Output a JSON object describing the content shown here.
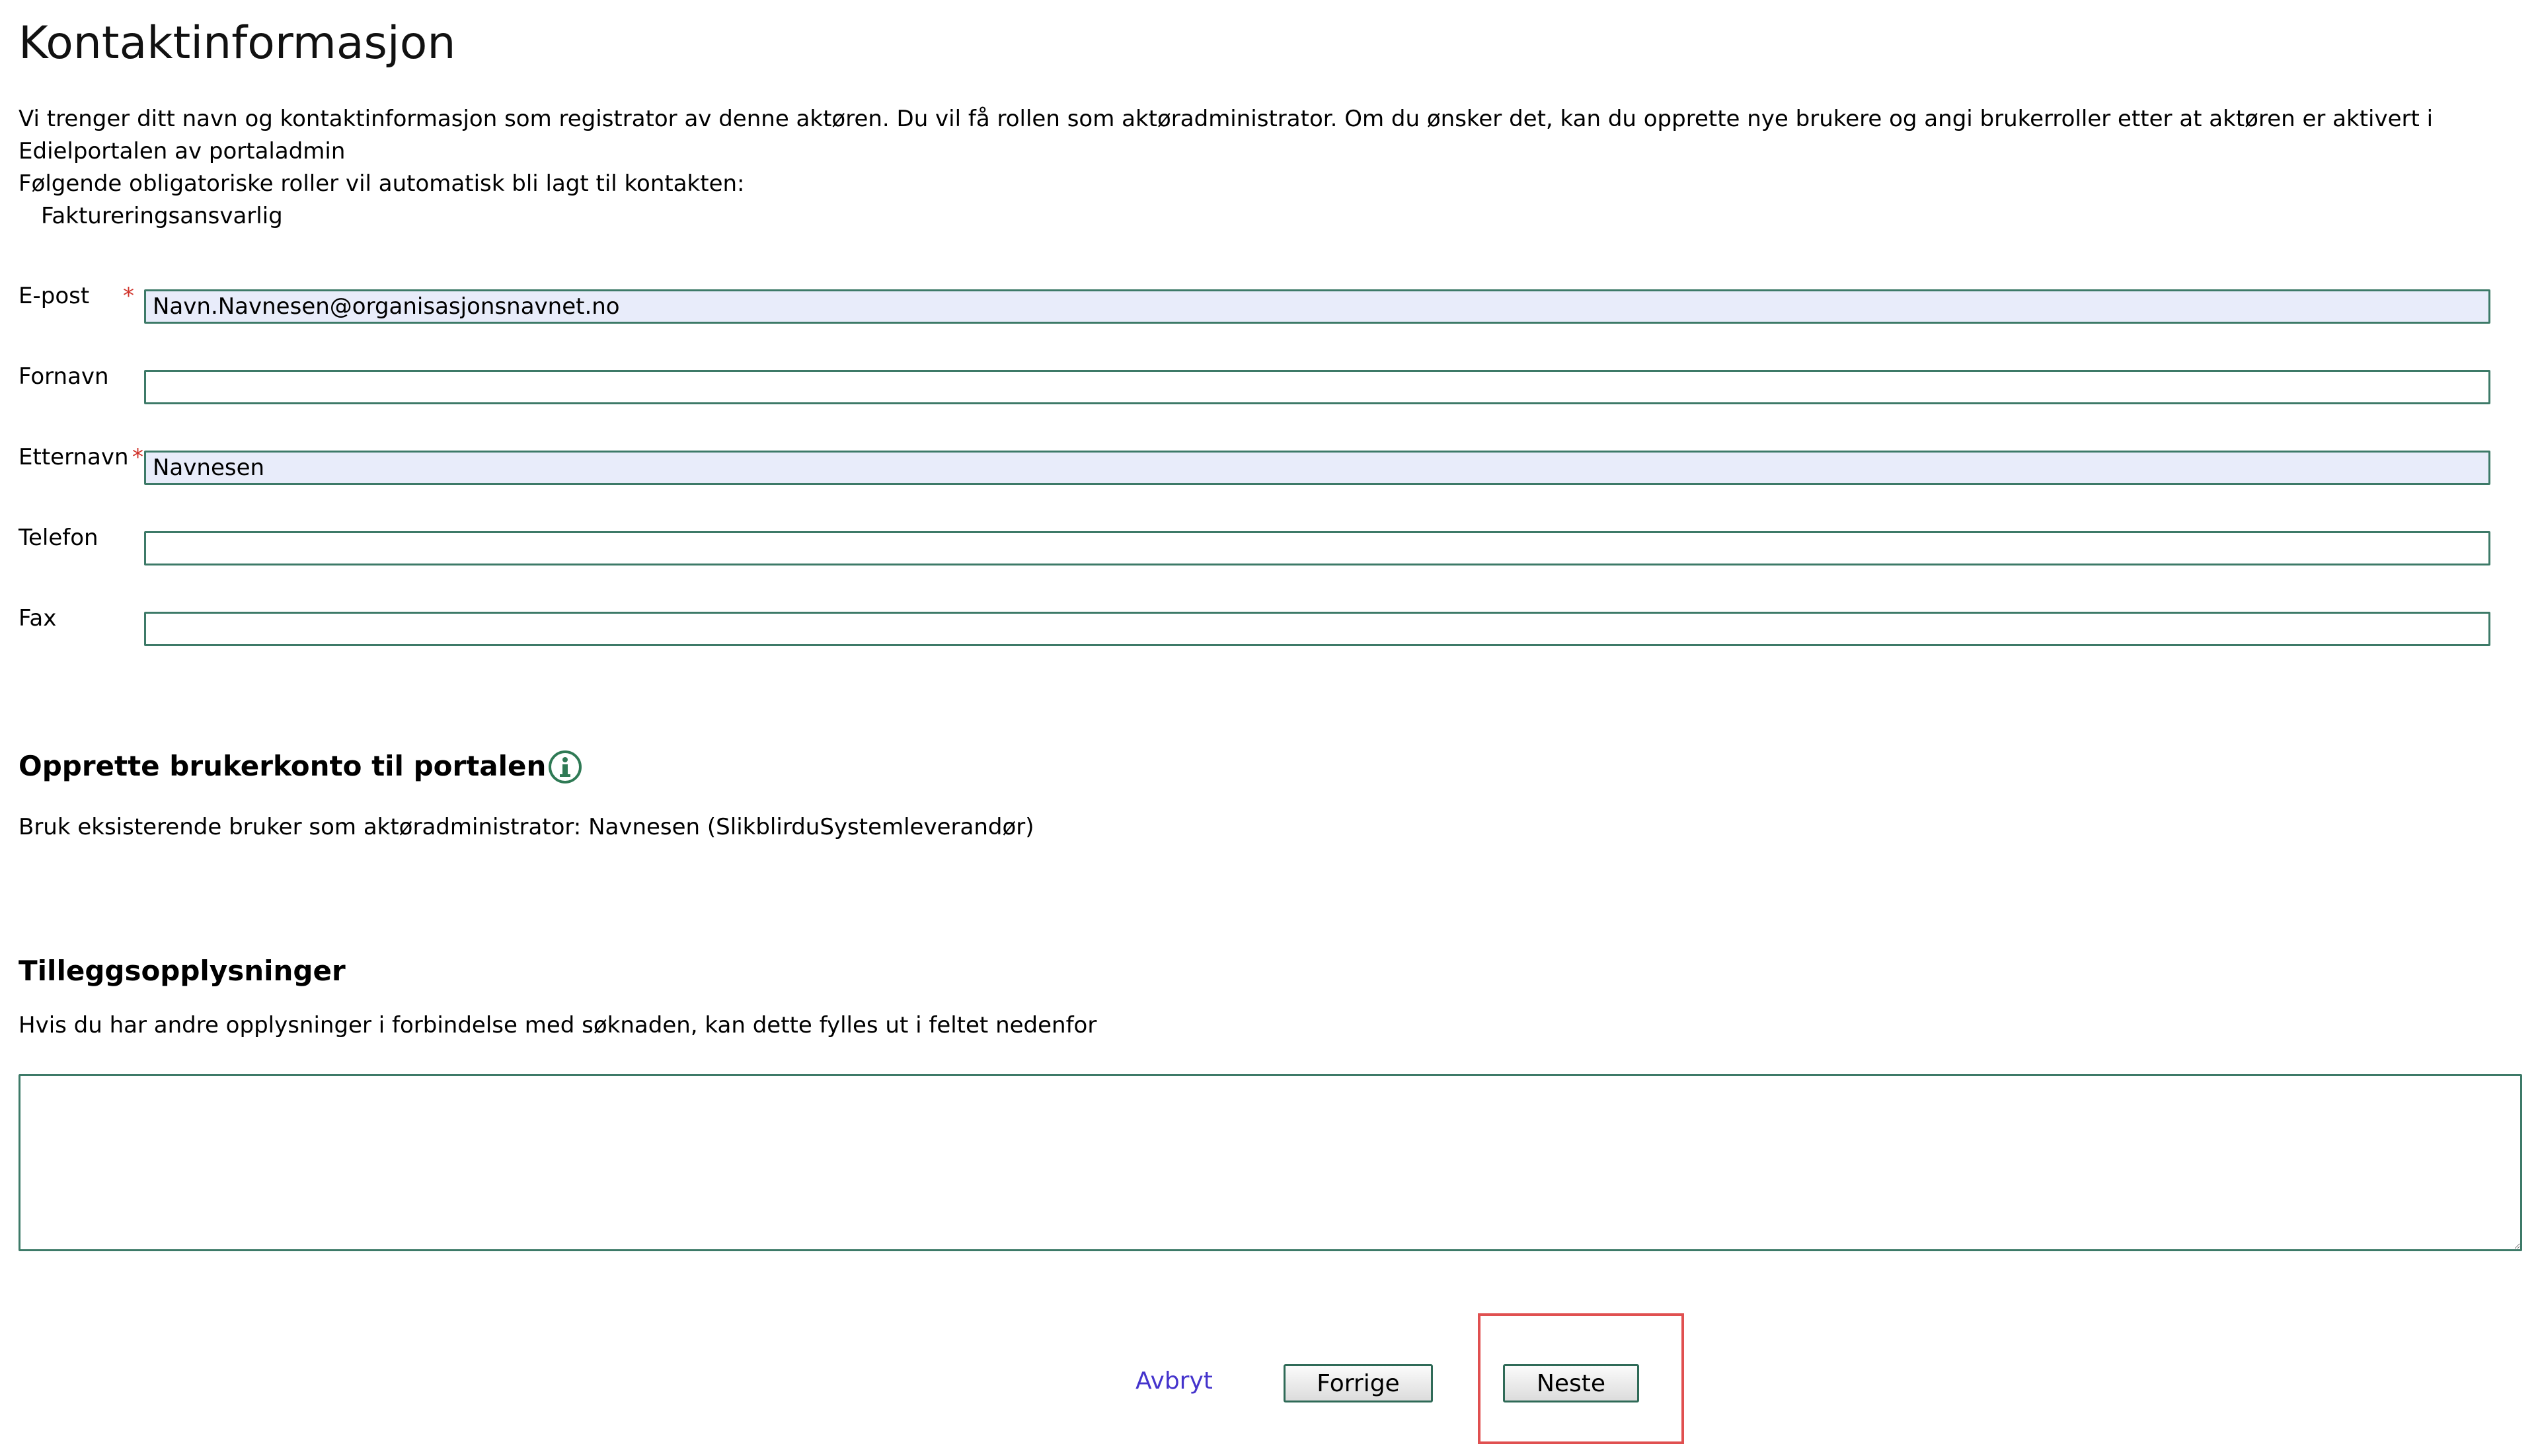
{
  "page": {
    "title": "Kontaktinformasjon"
  },
  "intro": {
    "line1": "Vi trenger ditt navn og kontaktinformasjon som registrator av denne aktøren. Du vil få rollen som aktøradministrator. Om du ønsker det, kan du opprette nye brukere og angi brukerroller etter at aktøren er aktivert i Edielportalen av portaladmin",
    "line2": "Følgende obligatoriske roller vil automatisk bli lagt til kontakten:",
    "roles": [
      "Faktureringsansvarlig"
    ]
  },
  "form": {
    "required_marker": "*",
    "fields": [
      {
        "label": "E-post",
        "value": "Navn.Navnesen@organisasjonsnavnet.no",
        "required": true
      },
      {
        "label": "Fornavn",
        "value": "",
        "required": false
      },
      {
        "label": "Etternavn",
        "value": "Navnesen",
        "required": true
      },
      {
        "label": "Telefon",
        "value": "",
        "required": false
      },
      {
        "label": "Fax",
        "value": "",
        "required": false
      }
    ]
  },
  "account_section": {
    "heading": "Opprette brukerkonto til portalen",
    "icon": "info-icon",
    "text": "Bruk eksisterende bruker som aktøradministrator: Navnesen (SlikblirduSystemleverandør)"
  },
  "extra_section": {
    "heading": "Tilleggsopplysninger",
    "text": "Hvis du har andre opplysninger i forbindelse med søknaden, kan dette fylles ut i feltet nedenfor",
    "notes_value": ""
  },
  "actions": {
    "cancel_label": "Avbryt",
    "previous_label": "Forrige",
    "next_label": "Neste"
  },
  "colors": {
    "input_border": "#3d7a68",
    "input_filled_bg": "#e8ecfa",
    "required_marker": "#d0342c",
    "link": "#4433cc",
    "highlight": "#e05050"
  }
}
